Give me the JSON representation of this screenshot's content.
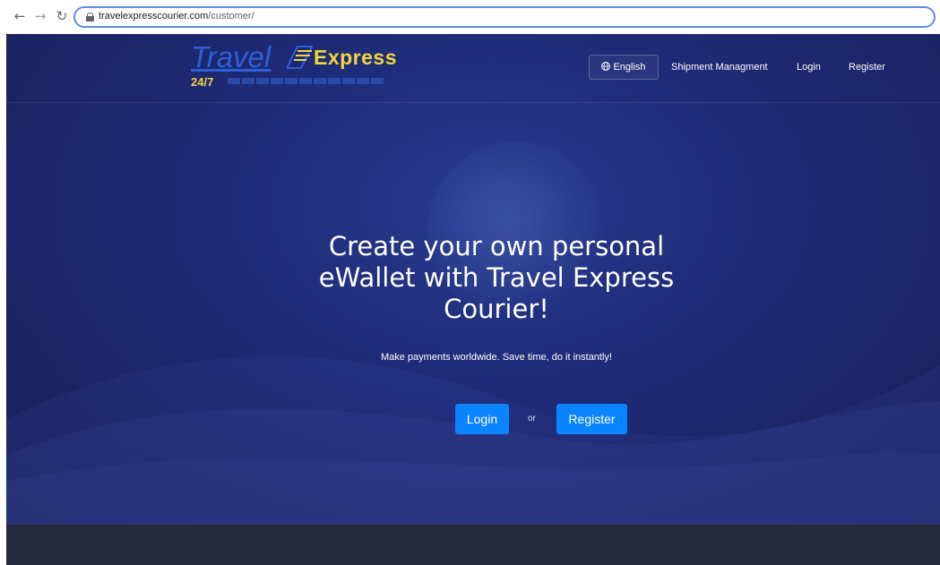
{
  "browser": {
    "url_host": "travelexpresscourier.com",
    "url_path": "/customer/",
    "icons": [
      "arrow-left-icon",
      "arrow-right-icon",
      "reload-icon",
      "lock-icon"
    ]
  },
  "logo": {
    "travel": "Travel",
    "express": "Express",
    "hours": "24/7"
  },
  "nav": {
    "language": "English",
    "shipment": "Shipment Managment",
    "login": "Login",
    "register": "Register"
  },
  "hero": {
    "title": "Create your own personal eWallet with Travel Express Courier!",
    "subtitle": "Make payments worldwide. Save time, do it instantly!",
    "login_button": "Login",
    "or_text": "or",
    "register_button": "Register"
  },
  "colors": {
    "hero_background": "#1f2c7a",
    "accent_button": "#0a84ff",
    "logo_blue": "#2d5fd6",
    "logo_yellow": "#f2d53c",
    "footer_band": "#242a3a"
  }
}
